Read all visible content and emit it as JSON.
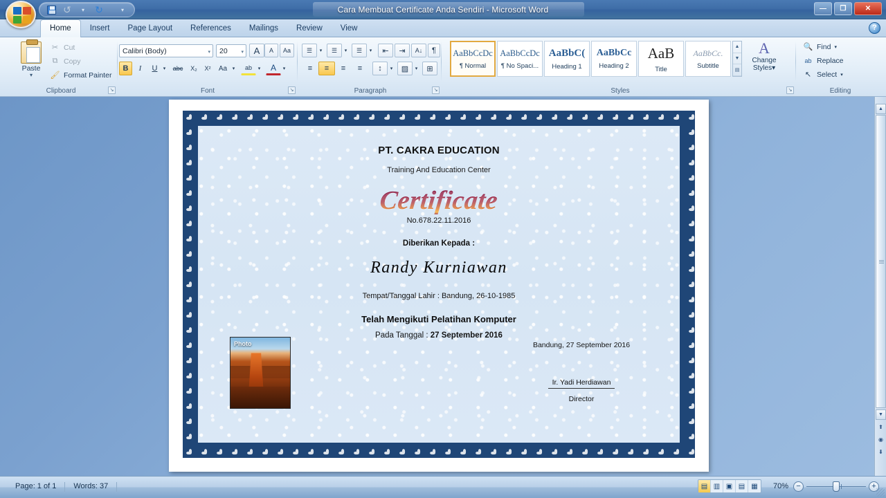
{
  "window": {
    "title": "Cara Membuat Certificate Anda Sendiri - Microsoft Word",
    "minimize_label": "—",
    "maximize_label": "❐",
    "close_label": "✕"
  },
  "quick_access": {
    "save_label": "Save",
    "undo_label": "Undo",
    "undo_caret": "▾",
    "redo_label": "Redo",
    "customize_caret": "▾"
  },
  "office_button": {
    "label": "Office"
  },
  "help_button": {
    "label": "?"
  },
  "ribbon": {
    "tabs": [
      {
        "label": "Home",
        "active": true
      },
      {
        "label": "Insert",
        "active": false
      },
      {
        "label": "Page Layout",
        "active": false
      },
      {
        "label": "References",
        "active": false
      },
      {
        "label": "Mailings",
        "active": false
      },
      {
        "label": "Review",
        "active": false
      },
      {
        "label": "View",
        "active": false
      }
    ],
    "groups": {
      "clipboard": {
        "label": "Clipboard",
        "paste_label": "Paste",
        "paste_caret": "▾",
        "cut_label": "Cut",
        "copy_label": "Copy",
        "format_painter_label": "Format Painter",
        "dialog_launcher": "↘"
      },
      "font": {
        "label": "Font",
        "font_name": "Calibri (Body)",
        "font_size": "20",
        "grow_font": "A",
        "shrink_font": "A",
        "clear_formatting": "Aa",
        "bold": "B",
        "italic": "I",
        "underline": "U",
        "strikethrough": "abc",
        "subscript": "X₂",
        "superscript": "X²",
        "change_case": "Aa",
        "highlight": "ab",
        "font_color": "A",
        "caret": "▾",
        "dialog_launcher": "↘"
      },
      "paragraph": {
        "label": "Paragraph",
        "bullets": "☰",
        "numbering": "☰",
        "multilevel": "☰",
        "decrease_indent": "⇤",
        "increase_indent": "⇥",
        "sort": "A↓",
        "show_marks": "¶",
        "align_left": "≡",
        "align_center": "≡",
        "align_right": "≡",
        "justify": "≡",
        "line_spacing": "↕",
        "shading": "▨",
        "borders": "⊞",
        "caret": "▾",
        "active_alignment": "align_center",
        "dialog_launcher": "↘"
      },
      "styles": {
        "label": "Styles",
        "items": [
          {
            "sample": "AaBbCcDc",
            "name": "¶ Normal",
            "selected": true
          },
          {
            "sample": "AaBbCcDc",
            "name": "¶ No Spaci...",
            "selected": false
          },
          {
            "sample": "AaBbC(",
            "name": "Heading 1",
            "selected": false
          },
          {
            "sample": "AaBbCc",
            "name": "Heading 2",
            "selected": false
          },
          {
            "sample": "AaB",
            "name": "Title",
            "selected": false
          },
          {
            "sample": "AaBbCc.",
            "name": "Subtitle",
            "selected": false
          }
        ],
        "scroll_up": "▲",
        "scroll_down": "▼",
        "more": "▤",
        "change_styles_label_1": "Change",
        "change_styles_label_2": "Styles",
        "change_styles_caret": "▾",
        "dialog_launcher": "↘"
      },
      "editing": {
        "label": "Editing",
        "find_label": "Find",
        "find_caret": "▾",
        "replace_label": "Replace",
        "select_label": "Select",
        "select_caret": "▾"
      }
    }
  },
  "document": {
    "certificate": {
      "company": "PT. CAKRA EDUCATION",
      "subtitle": "Training And Education Center",
      "wordart_title": "Certificate",
      "number": "No.678.22.11.2016",
      "given_to_label": "Diberikan Kepada :",
      "recipient_name": "Randy Kurniawan",
      "birth_line": "Tempat/Tanggal Lahir : Bandung, 26-10-1985",
      "course_line": "Telah Mengikuti Pelatihan Komputer",
      "date_label": "Pada Tanggal : ",
      "date_value": "27 September 2016",
      "sign_city_date": "Bandung, 27 September 2016",
      "signer_name": "Ir. Yadi Herdiawan",
      "signer_title": "Director",
      "photo_label": "Photo"
    }
  },
  "scrollbar": {
    "up_arrow": "▲",
    "down_arrow": "▼",
    "previous_page": "⬆",
    "select_browse_object": "◉",
    "next_page": "⬇"
  },
  "statusbar": {
    "page": "Page: 1 of 1",
    "words": "Words: 37",
    "views": [
      {
        "name": "print-layout",
        "glyph": "▤",
        "active": true
      },
      {
        "name": "full-screen-reading",
        "glyph": "▥",
        "active": false
      },
      {
        "name": "web-layout",
        "glyph": "▣",
        "active": false
      },
      {
        "name": "outline",
        "glyph": "▤",
        "active": false
      },
      {
        "name": "draft",
        "glyph": "▦",
        "active": false
      }
    ],
    "zoom": "70%",
    "zoom_out": "−",
    "zoom_in": "+"
  },
  "colors": {
    "title_bar": "#3f6ea8",
    "ribbon": "#e3eef8",
    "cert_border": "#1f4677",
    "cert_paper": "#dce9f6",
    "wordart_dark": "#7a0b34",
    "wordart_light": "#f4a521",
    "accent_gold": "#f9c74f"
  }
}
